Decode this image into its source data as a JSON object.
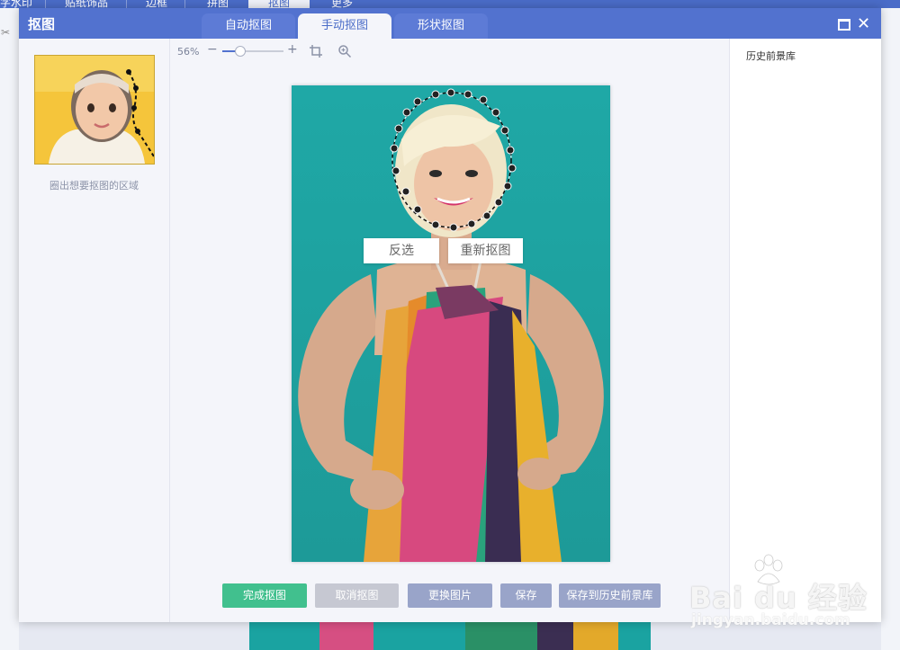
{
  "background_app": {
    "tabs": [
      "字水印",
      "贴纸饰品",
      "边框",
      "拼图",
      "抠图",
      "更多"
    ],
    "active_tab_index": 4
  },
  "dialog": {
    "title": "抠图",
    "tabs": [
      "自动抠图",
      "手动抠图",
      "形状抠图"
    ],
    "active_tab_index": 1
  },
  "left_panel": {
    "caption": "圈出想要抠图的区域"
  },
  "toolbar": {
    "zoom_label": "56%",
    "zoom_value_percent": 56,
    "minus": "−",
    "plus": "+"
  },
  "context_menu": {
    "invert": "反选",
    "redo": "重新抠图"
  },
  "actions": {
    "finish": "完成抠图",
    "cancel": "取消抠图",
    "replace": "更换图片",
    "save": "保存",
    "save_history": "保存到历史前景库"
  },
  "right_panel": {
    "title": "历史前景库"
  },
  "watermark": {
    "main": "Bai du 经验",
    "sub": "jingyan.baidu.com"
  },
  "colors": {
    "title_bar": "#5272cf",
    "finish_btn": "#41c08e",
    "cancel_btn": "#c6c8d2",
    "secondary_btn": "#99a4c9",
    "canvas_bg": "#1aa3a1"
  }
}
